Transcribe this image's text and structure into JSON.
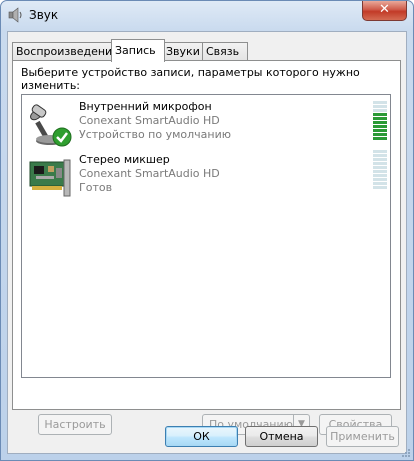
{
  "window": {
    "title": "Звук",
    "close_label": "✕"
  },
  "tabs": [
    {
      "label": "Воспроизведение"
    },
    {
      "label": "Запись"
    },
    {
      "label": "Звуки"
    },
    {
      "label": "Связь"
    }
  ],
  "instruction": "Выберите устройство записи, параметры которого нужно изменить:",
  "devices": [
    {
      "name": "Внутренний микрофон",
      "driver": "Conexant SmartAudio HD",
      "status": "Устройство по умолчанию",
      "icon": "microphone-icon",
      "default_check": true,
      "level_segments_active": 7,
      "level_segments_total": 10
    },
    {
      "name": "Стерео микшер",
      "driver": "Conexant SmartAudio HD",
      "status": "Готов",
      "icon": "sound-card-icon",
      "default_check": false,
      "level_segments_active": 0,
      "level_segments_total": 10
    }
  ],
  "panel_buttons": {
    "configure": "Настроить",
    "set_default": "По умолчанию",
    "properties": "Свойства"
  },
  "dialog_buttons": {
    "ok": "ОК",
    "cancel": "Отмена",
    "apply": "Применить"
  },
  "colors": {
    "meter_active": "#2a9a35",
    "meter_inactive": "#d3e3e8",
    "title_bar": "#c9daee"
  }
}
